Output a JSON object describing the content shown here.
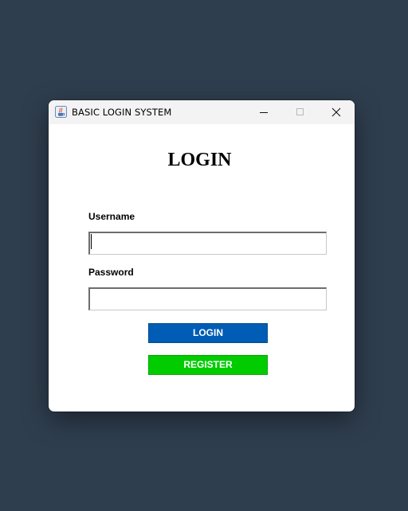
{
  "window": {
    "title": "BASIC LOGIN SYSTEM",
    "app_icon": "java-cup-icon",
    "controls": {
      "minimize_icon": "minimize-icon",
      "maximize_icon": "maximize-icon",
      "close_icon": "close-icon"
    }
  },
  "form": {
    "heading": "LOGIN",
    "username_label": "Username",
    "username_value": "",
    "password_label": "Password",
    "password_value": "",
    "login_label": "LOGIN",
    "register_label": "REGISTER"
  },
  "colors": {
    "background": "#2f3e4f",
    "login_button": "#005cb5",
    "register_button": "#00cc00"
  }
}
